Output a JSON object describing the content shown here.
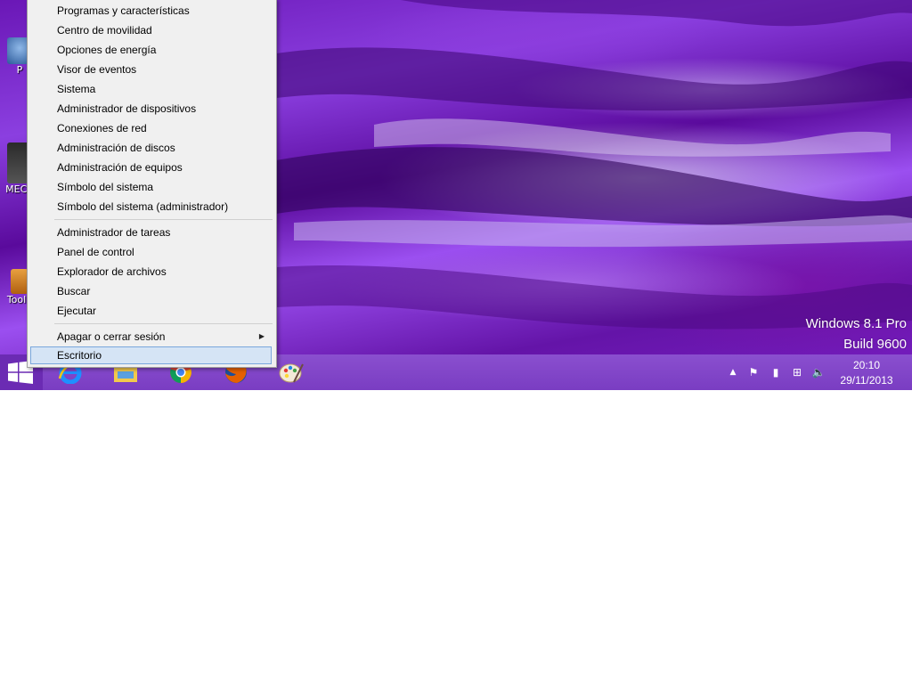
{
  "winx_menu": {
    "items_group1": [
      "Programas y características",
      "Centro de movilidad",
      "Opciones de energía",
      "Visor de eventos",
      "Sistema",
      "Administrador de dispositivos",
      "Conexiones de red",
      "Administración de discos",
      "Administración de equipos",
      "Símbolo del sistema",
      "Símbolo del sistema (administrador)"
    ],
    "items_group2": [
      "Administrador de tareas",
      "Panel de control",
      "Explorador de archivos",
      "Buscar",
      "Ejecutar"
    ],
    "shutdown_item": "Apagar o cerrar sesión",
    "desktop_item": "Escritorio"
  },
  "desktop_icons": [
    {
      "label": "P",
      "icon": "app-icon"
    },
    {
      "label": "MECA",
      "icon": "document-icon"
    },
    {
      "label": "Toolb",
      "icon": "toolbox-icon"
    }
  ],
  "watermark": {
    "line1": "Windows 8.1 Pro",
    "line2": "Build 9600"
  },
  "taskbar": {
    "apps": [
      "internet-explorer-icon",
      "file-explorer-icon",
      "chrome-icon",
      "firefox-icon",
      "paint-icon"
    ],
    "clock": {
      "time": "20:10",
      "date": "29/11/2013"
    }
  },
  "colors": {
    "accent": "#7a3dc2",
    "menu_background": "#f0f0f0",
    "selection": "#d5e4f5"
  }
}
